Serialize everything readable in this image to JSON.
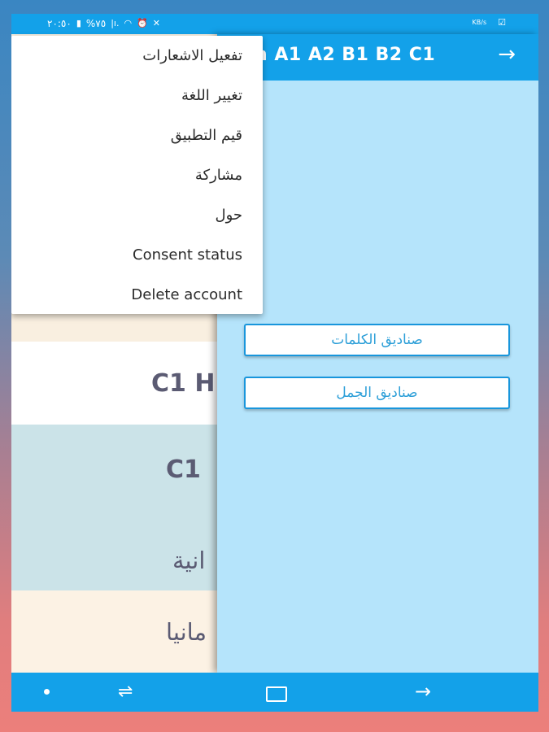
{
  "status_bar": {
    "time": "٢٠:٥٠",
    "battery": "%٧٥",
    "icons": [
      "battery-icon",
      "signal-icon",
      "wifi-icon",
      "alarm-icon",
      "mute-icon",
      "email-notification-icon",
      "speed-icon"
    ],
    "speed_label": "KB/s"
  },
  "background_list": {
    "rows": [
      {
        "label": ""
      },
      {
        "label": "C1 H"
      },
      {
        "label": "C1",
        "label2": "انية"
      },
      {
        "label": "مانيا"
      }
    ]
  },
  "drawer": {
    "title": "n A1 A2 B1 B2 C1",
    "buttons": [
      "صناديق الكلمات",
      "صناديق الجمل"
    ]
  },
  "menu": {
    "items": [
      "تفعيل الاشعارات",
      "تغيير اللغة",
      "قيم التطبيق",
      "مشاركة",
      "حول",
      "Consent status",
      "Delete account"
    ]
  },
  "nav_bar": {
    "icons": [
      "assistant-dot-icon",
      "recent-apps-icon",
      "home-icon",
      "back-icon"
    ]
  },
  "colors": {
    "accent": "#13a1e9",
    "drawer_bg": "#b5e4fb",
    "button_text": "#2d9fd8"
  }
}
